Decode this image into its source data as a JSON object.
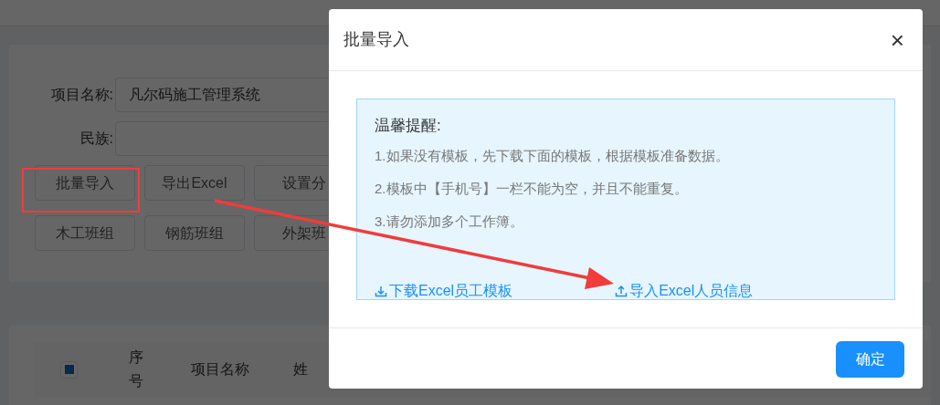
{
  "filters": [
    {
      "label": "项目名称:",
      "value": "凡尔码施工管理系统"
    },
    {
      "label": "民族:"
    }
  ],
  "action_buttons": [
    "批量导入",
    "导出Excel",
    "设置分"
  ],
  "group_buttons": [
    "木工班组",
    "钢筋班组",
    "外架班"
  ],
  "table": {
    "select_all": {
      "indeterminate": true
    },
    "columns": [
      "序号",
      "项目名称",
      "姓"
    ]
  },
  "dialog": {
    "title": "批量导入",
    "close": "×",
    "notice": {
      "heading": "温馨提醒:",
      "items": [
        "1.如果没有模板，先下载下面的模板，根据模板准备数据。",
        "2.模板中【手机号】一栏不能为空，并且不能重复。",
        "3.请勿添加多个工作簿。"
      ]
    },
    "links": [
      {
        "kind": "download",
        "label": "下载Excel员工模板"
      },
      {
        "kind": "upload",
        "label": "导入Excel人员信息"
      }
    ],
    "confirm": "确定"
  }
}
